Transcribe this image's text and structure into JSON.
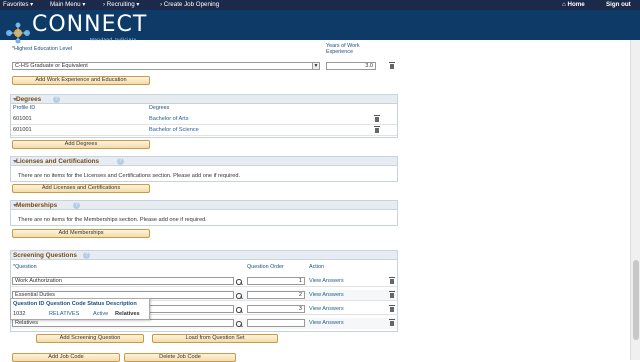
{
  "nav": {
    "favorites": "Favorites",
    "main_menu": "Main Menu",
    "breadcrumb_1": "Recruiting",
    "breadcrumb_2": "Create Job Opening",
    "home": "Home",
    "sign_out": "Sign out"
  },
  "brand": {
    "title": "CONNECT",
    "subtitle": "Maryland Judiciary"
  },
  "education": {
    "col_level": "*Highest Education Level",
    "col_years": "Years of Work Experience",
    "level_value": "C-HS Graduate or Equivalent",
    "years_value": "3.0",
    "add_button": "Add Work Experience and Education"
  },
  "degrees": {
    "title": "Degrees",
    "col_profile": "Profile ID",
    "col_degree": "Degrees",
    "rows": [
      {
        "profile": "601001",
        "degree": "Bachelor of Arts"
      },
      {
        "profile": "601001",
        "degree": "Bachelor of Science"
      }
    ],
    "add_button": "Add Degrees"
  },
  "licenses": {
    "title": "Licenses and Certifications",
    "empty": "There are no items for the Licenses and Certifications section.  Please add one if required.",
    "add_button": "Add Licenses and Certifications"
  },
  "memberships": {
    "title": "Memberships",
    "empty": "There are no items for the Memberships section.  Please add one if required.",
    "add_button": "Add Memberships"
  },
  "screening": {
    "title": "Screening Questions",
    "col_question": "*Question",
    "col_order": "Question Order",
    "col_action": "Action",
    "rows": [
      {
        "question": "Work Authorization",
        "order": "1",
        "action": "View Answers"
      },
      {
        "question": "Essential Duties",
        "order": "2",
        "action": "View Answers"
      },
      {
        "question": "",
        "order": "3",
        "action": "View Answers"
      },
      {
        "question": "Relatives",
        "order": "",
        "action": "View Answers"
      }
    ],
    "popup": {
      "headers": [
        "Question ID",
        "Question Code",
        "Status",
        "Description"
      ],
      "row": [
        "1032",
        "RELATIVES",
        "Active",
        "Relatives"
      ]
    },
    "add_button": "Add Screening Question",
    "load_button": "Load from Question Set"
  },
  "bottom": {
    "add_job_code": "Add Job Code",
    "delete_job_code": "Delete Job Code"
  },
  "colors": {
    "topbar": "#1b2a4a",
    "brand": "#0d3a66",
    "section_title": "#7a4b14",
    "link": "#1f5c99"
  }
}
